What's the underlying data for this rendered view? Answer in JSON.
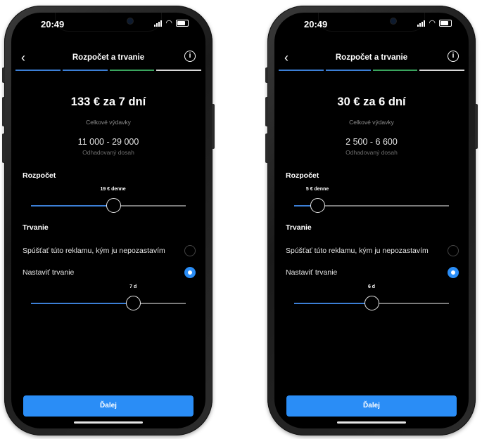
{
  "phones": [
    {
      "status": {
        "time": "20:49"
      },
      "header": {
        "title": "Rozpočet a trvanie",
        "back_icon": "chevron-left-icon",
        "info_icon": "info-icon"
      },
      "summary": {
        "headline": "133 € za 7 dní",
        "spend_label": "Celkové výdavky",
        "reach": "11 000 - 29 000",
        "reach_label": "Odhadovaný dosah"
      },
      "budget": {
        "label": "Rozpočet",
        "value_label": "19 € denne",
        "fraction": 0.53
      },
      "duration": {
        "label": "Trvanie",
        "option_continuous": "Spúšťať túto reklamu, kým ju nepozastavím",
        "option_set": "Nastaviť trvanie",
        "selected": "set",
        "value_label": "7 d",
        "fraction": 0.66
      },
      "next_label": "Ďalej"
    },
    {
      "status": {
        "time": "20:49"
      },
      "header": {
        "title": "Rozpočet a trvanie",
        "back_icon": "chevron-left-icon",
        "info_icon": "info-icon"
      },
      "summary": {
        "headline": "30 € za 6 dní",
        "spend_label": "Celkové výdavky",
        "reach": "2 500 - 6 600",
        "reach_label": "Odhadovaný dosah"
      },
      "budget": {
        "label": "Rozpočet",
        "value_label": "5 € denne",
        "fraction": 0.15
      },
      "duration": {
        "label": "Trvanie",
        "option_continuous": "Spúšťať túto reklamu, kým ju nepozastavím",
        "option_set": "Nastaviť trvanie",
        "selected": "set",
        "value_label": "6 d",
        "fraction": 0.5
      },
      "next_label": "Ďalej"
    }
  ],
  "colors": {
    "accent": "#2a8df6",
    "track_fill": "#3c7fd6",
    "track": "#7b7b7b",
    "step_done": "#3aa55e",
    "background": "#000000"
  }
}
